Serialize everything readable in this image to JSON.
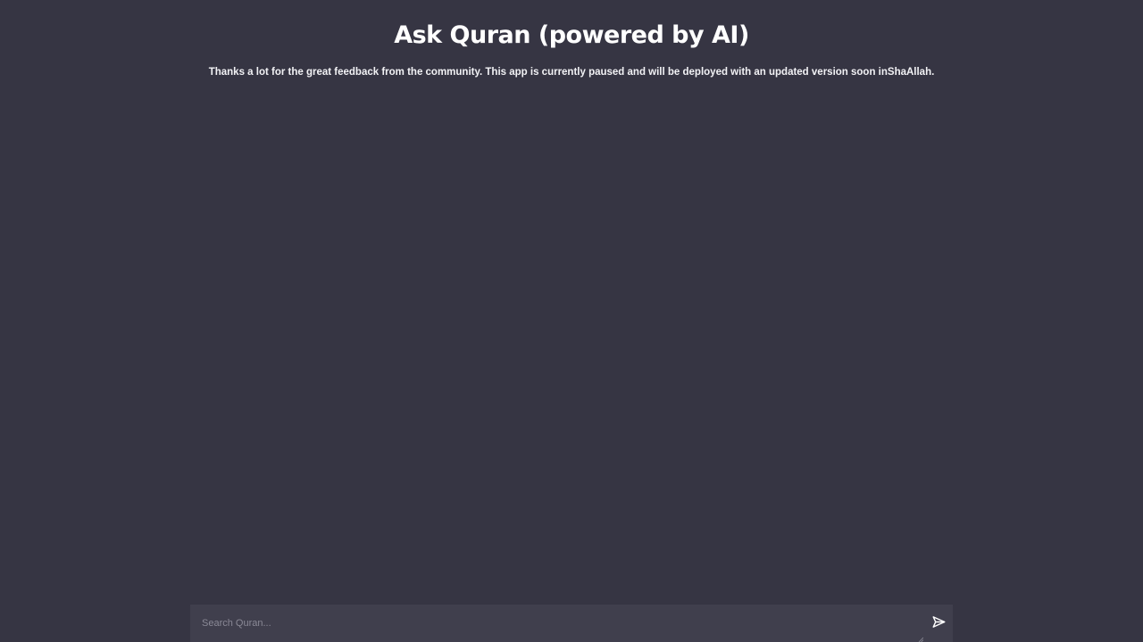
{
  "header": {
    "title": "Ask Quran (powered by AI)",
    "notice": "Thanks a lot for the great feedback from the community. This app is currently paused and will be deployed with an updated version soon inShaAllah."
  },
  "search": {
    "placeholder": "Search Quran...",
    "value": ""
  },
  "icons": {
    "send": "send-icon",
    "resize": "resize-handle-icon"
  },
  "colors": {
    "background": "#363543",
    "input_background": "#403f4d",
    "text": "#ffffff",
    "placeholder": "#8a8996"
  }
}
